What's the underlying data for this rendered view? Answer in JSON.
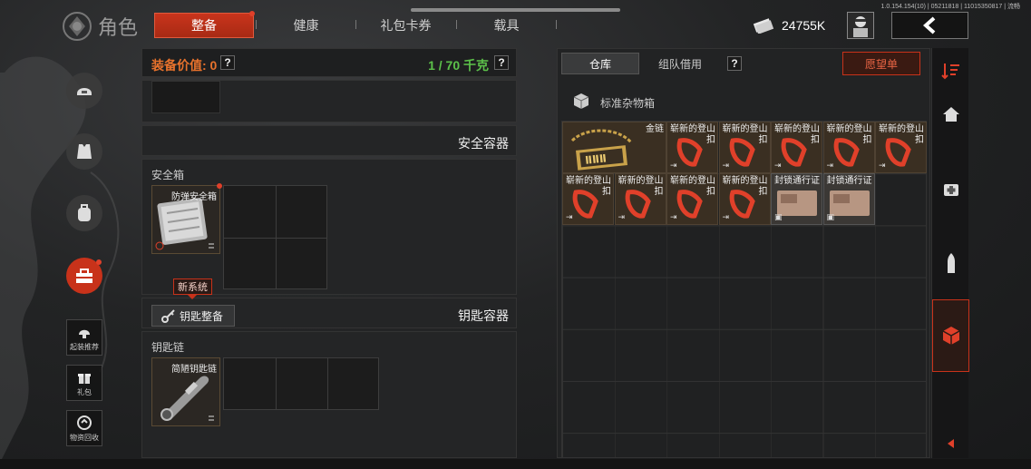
{
  "version": "1.0.154.154(10) | 05211818 | 11015350817 | 流畅",
  "header": {
    "title": "角色",
    "tabs": [
      {
        "label": "整备",
        "active": true
      },
      {
        "label": "健康",
        "active": false
      },
      {
        "label": "礼包卡券",
        "active": false
      },
      {
        "label": "载具",
        "active": false
      }
    ],
    "currency": "24755K"
  },
  "left_nav": {
    "buttons": [
      {
        "label": "起装推荐",
        "icon": "loadout-icon"
      },
      {
        "label": "礼包",
        "icon": "gift-icon"
      },
      {
        "label": "物资回收",
        "icon": "recycle-icon"
      }
    ]
  },
  "equipment": {
    "value_label": "装备价值: 0",
    "help": "?",
    "weight": "1 / 70 千克",
    "secure_container_title": "安全容器",
    "safe_box_title": "安全箱",
    "safe_box_item": "防弹安全箱",
    "new_system_tag": "新系统",
    "key_button": "钥匙整备",
    "key_container_title": "钥匙容器",
    "key_chain_title": "钥匙链",
    "key_chain_item": "简陋钥匙链"
  },
  "warehouse": {
    "tabs": [
      {
        "label": "仓库",
        "active": true
      },
      {
        "label": "组队借用",
        "active": false
      }
    ],
    "help": "?",
    "wishlist": "愿望单",
    "box_title": "标准杂物箱",
    "items": [
      {
        "name": "金链",
        "type": "gold"
      },
      {
        "name": "崭新的登山扣",
        "type": "carabiner"
      },
      {
        "name": "崭新的登山扣",
        "type": "carabiner"
      },
      {
        "name": "崭新的登山扣",
        "type": "carabiner"
      },
      {
        "name": "崭新的登山扣",
        "type": "carabiner"
      },
      {
        "name": "崭新的登山扣",
        "type": "carabiner"
      },
      {
        "name": "崭新的登山扣",
        "type": "carabiner"
      },
      {
        "name": "崭新的登山扣",
        "type": "carabiner"
      },
      {
        "name": "崭新的登山扣",
        "type": "carabiner"
      },
      {
        "name": "崭新的登山扣",
        "type": "carabiner"
      },
      {
        "name": "封锁通行证",
        "type": "pass"
      },
      {
        "name": "封锁通行证",
        "type": "pass"
      }
    ]
  },
  "colors": {
    "accent": "#c8321a",
    "orange": "#e8722c",
    "green": "#5cc14a"
  }
}
